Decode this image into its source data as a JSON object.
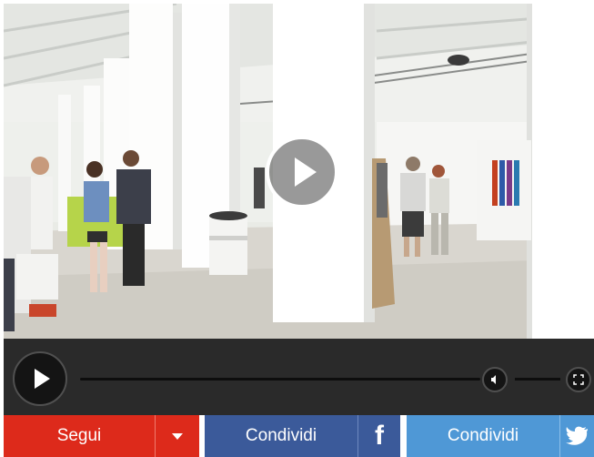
{
  "player": {
    "big_play_icon": "play-icon",
    "controls": {
      "play_icon": "play-icon",
      "volume_icon": "volume-icon",
      "fullscreen_icon": "fullscreen-icon"
    }
  },
  "share_bar": {
    "follow_label": "Segui",
    "follow_dropdown_icon": "caret-down-icon",
    "facebook_label": "Condividi",
    "facebook_icon_text": "f",
    "twitter_label": "Condividi",
    "twitter_icon": "twitter-bird-icon",
    "colors": {
      "follow": "#dd2a1b",
      "facebook": "#3b5a9a",
      "twitter": "#4f98d6"
    }
  }
}
